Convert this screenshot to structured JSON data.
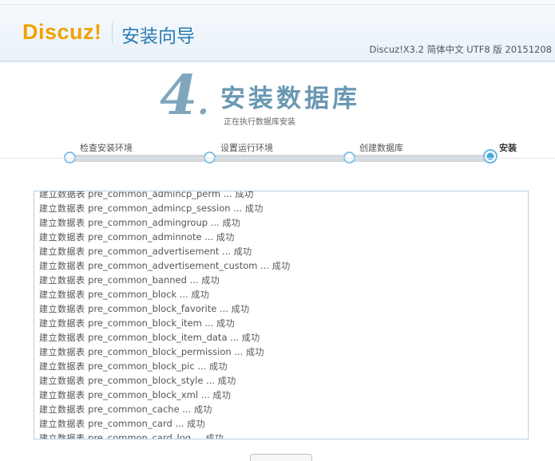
{
  "header": {
    "logo": "Discuz!",
    "title": "安装向导",
    "version": "Discuz!X3.2 简体中文 UTF8 版 20151208"
  },
  "step": {
    "number": "4",
    "number_suffix": ".",
    "title": "安装数据库",
    "subtitle": "正在执行数据库安装"
  },
  "progress": {
    "steps": [
      {
        "label": "检查安装环境",
        "state": "done"
      },
      {
        "label": "设置运行环境",
        "state": "done"
      },
      {
        "label": "创建数据库",
        "state": "done"
      },
      {
        "label": "安装",
        "state": "active"
      }
    ]
  },
  "log": {
    "partial_top": "建立数据表 pre_common_admincp_perm ... 成功",
    "prefix": "建立数据表",
    "suffix": "成功",
    "entries": [
      "pre_common_admincp_session",
      "pre_common_admingroup",
      "pre_common_adminnote",
      "pre_common_advertisement",
      "pre_common_advertisement_custom",
      "pre_common_banned",
      "pre_common_block",
      "pre_common_block_favorite",
      "pre_common_block_item",
      "pre_common_block_item_data",
      "pre_common_block_permission",
      "pre_common_block_pic",
      "pre_common_block_style",
      "pre_common_block_xml",
      "pre_common_cache",
      "pre_common_card",
      "pre_common_card_log"
    ]
  },
  "colors": {
    "logo": "#f2a100",
    "title": "#2b7bb0",
    "step_number": "#7fa6bd",
    "accent": "#4ba8df"
  }
}
